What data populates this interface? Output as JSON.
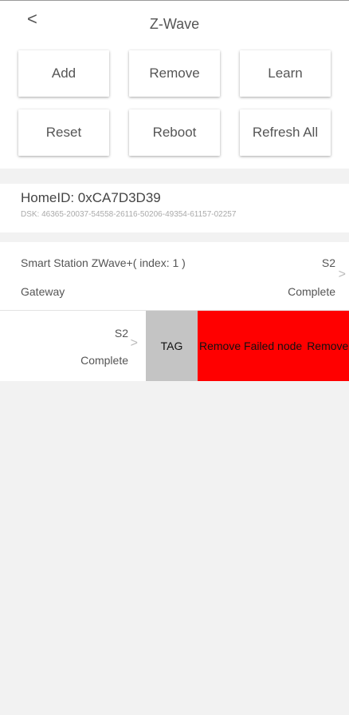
{
  "header": {
    "back_glyph": "<",
    "title": "Z-Wave"
  },
  "actions": {
    "row1": [
      "Add",
      "Remove",
      "Learn"
    ],
    "row2": [
      "Reset",
      "Reboot",
      "Refresh All"
    ]
  },
  "home": {
    "home_id": "HomeID: 0xCA7D3D39",
    "dsk": "DSK: 46365-20037-54558-26116-50206-49354-61157-02257"
  },
  "device": {
    "name": "Smart Station ZWave+( index: 1 )",
    "type": "Gateway",
    "security": "S2",
    "status": "Complete",
    "chevron": ">"
  },
  "swiped_device": {
    "security": "S2",
    "status": "Complete",
    "chevron": ">",
    "actions": {
      "tag": "TAG",
      "remove_failed": "Remove Failed node",
      "remove": "Remove"
    }
  },
  "colors": {
    "accent_red": "#ff0000",
    "tag_gray": "#c4c4c4",
    "background": "#f2f2f2"
  }
}
